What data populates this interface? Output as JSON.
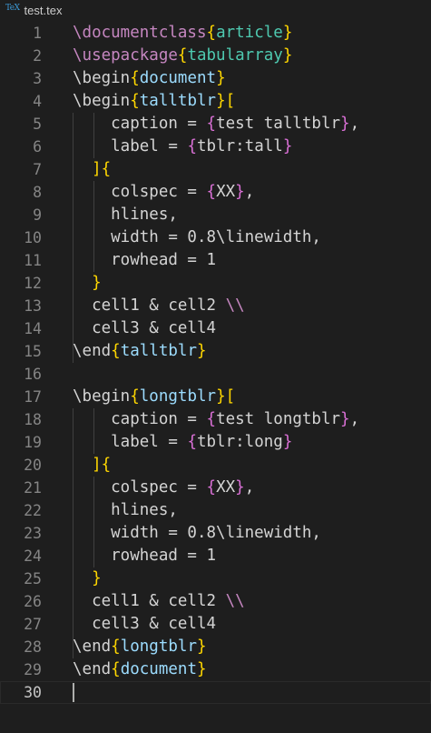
{
  "tab": {
    "icon": "tex-file-icon",
    "icon_text": "TeX",
    "title": "test.tex"
  },
  "editor": {
    "active_line": 30,
    "lines": [
      {
        "n": "1",
        "segs": [
          [
            "cmd",
            "\\documentclass"
          ],
          [
            "br",
            "{"
          ],
          [
            "arg",
            "article"
          ],
          [
            "br",
            "}"
          ]
        ]
      },
      {
        "n": "2",
        "segs": [
          [
            "cmd",
            "\\usepackage"
          ],
          [
            "br",
            "{"
          ],
          [
            "arg",
            "tabularray"
          ],
          [
            "br",
            "}"
          ]
        ]
      },
      {
        "n": "3",
        "segs": [
          [
            "txt",
            "\\begin"
          ],
          [
            "br",
            "{"
          ],
          [
            "env",
            "document"
          ],
          [
            "br",
            "}"
          ]
        ]
      },
      {
        "n": "4",
        "segs": [
          [
            "txt",
            "\\begin"
          ],
          [
            "br",
            "{"
          ],
          [
            "env",
            "talltblr"
          ],
          [
            "br",
            "}"
          ],
          [
            "br",
            "["
          ]
        ]
      },
      {
        "n": "5",
        "segs": [
          [
            "txt",
            "    caption = "
          ],
          [
            "br2",
            "{"
          ],
          [
            "txt",
            "test talltblr"
          ],
          [
            "br2",
            "}"
          ],
          [
            "txt",
            ","
          ]
        ]
      },
      {
        "n": "6",
        "segs": [
          [
            "txt",
            "    label = "
          ],
          [
            "br2",
            "{"
          ],
          [
            "txt",
            "tblr:tall"
          ],
          [
            "br2",
            "}"
          ]
        ]
      },
      {
        "n": "7",
        "segs": [
          [
            "txt",
            "  "
          ],
          [
            "br",
            "]{"
          ]
        ]
      },
      {
        "n": "8",
        "segs": [
          [
            "txt",
            "    colspec = "
          ],
          [
            "br2",
            "{"
          ],
          [
            "txt",
            "XX"
          ],
          [
            "br2",
            "}"
          ],
          [
            "txt",
            ","
          ]
        ]
      },
      {
        "n": "9",
        "segs": [
          [
            "txt",
            "    hlines,"
          ]
        ]
      },
      {
        "n": "10",
        "segs": [
          [
            "txt",
            "    width = 0.8\\linewidth,"
          ]
        ]
      },
      {
        "n": "11",
        "segs": [
          [
            "txt",
            "    rowhead = 1"
          ]
        ]
      },
      {
        "n": "12",
        "segs": [
          [
            "txt",
            "  "
          ],
          [
            "br",
            "}"
          ]
        ]
      },
      {
        "n": "13",
        "segs": [
          [
            "txt",
            "  cell1 & cell2 "
          ],
          [
            "cmd",
            "\\\\"
          ]
        ]
      },
      {
        "n": "14",
        "segs": [
          [
            "txt",
            "  cell3 & cell4"
          ]
        ]
      },
      {
        "n": "15",
        "segs": [
          [
            "txt",
            "\\end"
          ],
          [
            "br",
            "{"
          ],
          [
            "env",
            "talltblr"
          ],
          [
            "br",
            "}"
          ]
        ]
      },
      {
        "n": "16",
        "segs": []
      },
      {
        "n": "17",
        "segs": [
          [
            "txt",
            "\\begin"
          ],
          [
            "br",
            "{"
          ],
          [
            "env",
            "longtblr"
          ],
          [
            "br",
            "}"
          ],
          [
            "br",
            "["
          ]
        ]
      },
      {
        "n": "18",
        "segs": [
          [
            "txt",
            "    caption = "
          ],
          [
            "br2",
            "{"
          ],
          [
            "txt",
            "test longtblr"
          ],
          [
            "br2",
            "}"
          ],
          [
            "txt",
            ","
          ]
        ]
      },
      {
        "n": "19",
        "segs": [
          [
            "txt",
            "    label = "
          ],
          [
            "br2",
            "{"
          ],
          [
            "txt",
            "tblr:long"
          ],
          [
            "br2",
            "}"
          ]
        ]
      },
      {
        "n": "20",
        "segs": [
          [
            "txt",
            "  "
          ],
          [
            "br",
            "]{"
          ]
        ]
      },
      {
        "n": "21",
        "segs": [
          [
            "txt",
            "    colspec = "
          ],
          [
            "br2",
            "{"
          ],
          [
            "txt",
            "XX"
          ],
          [
            "br2",
            "}"
          ],
          [
            "txt",
            ","
          ]
        ]
      },
      {
        "n": "22",
        "segs": [
          [
            "txt",
            "    hlines,"
          ]
        ]
      },
      {
        "n": "23",
        "segs": [
          [
            "txt",
            "    width = 0.8\\linewidth,"
          ]
        ]
      },
      {
        "n": "24",
        "segs": [
          [
            "txt",
            "    rowhead = 1"
          ]
        ]
      },
      {
        "n": "25",
        "segs": [
          [
            "txt",
            "  "
          ],
          [
            "br",
            "}"
          ]
        ]
      },
      {
        "n": "26",
        "segs": [
          [
            "txt",
            "  cell1 & cell2 "
          ],
          [
            "cmd",
            "\\\\"
          ]
        ]
      },
      {
        "n": "27",
        "segs": [
          [
            "txt",
            "  cell3 & cell4"
          ]
        ]
      },
      {
        "n": "28",
        "segs": [
          [
            "txt",
            "\\end"
          ],
          [
            "br",
            "{"
          ],
          [
            "env",
            "longtblr"
          ],
          [
            "br",
            "}"
          ]
        ]
      },
      {
        "n": "29",
        "segs": [
          [
            "txt",
            "\\end"
          ],
          [
            "br",
            "{"
          ],
          [
            "env",
            "document"
          ],
          [
            "br",
            "}"
          ]
        ]
      },
      {
        "n": "30",
        "segs": []
      }
    ]
  }
}
